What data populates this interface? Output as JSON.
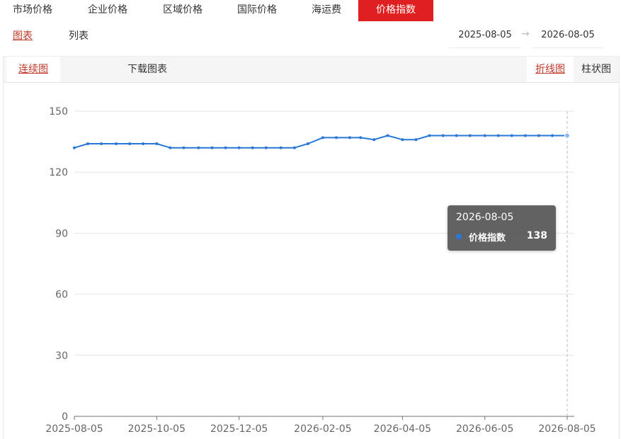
{
  "top_tabs": [
    "市场价格",
    "企业价格",
    "区域价格",
    "国际价格",
    "海运费",
    "价格指数"
  ],
  "sub_nav": {
    "chart": "图表",
    "list": "列表"
  },
  "date_range": {
    "start": "2025-08-05",
    "end": "2026-08-05",
    "separator": "→"
  },
  "toolbar": {
    "continuous_chart": "连续图",
    "download_chart": "下载图表",
    "line_chart": "折线图",
    "bar_chart": "柱状图"
  },
  "tooltip": {
    "date": "2026-08-05",
    "series_name": "价格指数",
    "value": "138"
  },
  "colors": {
    "accent": "#e02020",
    "series": "#2a78d6",
    "link": "#c0392b"
  },
  "chart_data": {
    "type": "line",
    "x_ticks": [
      "2025-08-05",
      "2025-10-05",
      "2025-12-05",
      "2026-02-05",
      "2026-04-05",
      "2026-06-05",
      "2026-08-05"
    ],
    "y_ticks": [
      0,
      30,
      60,
      90,
      120,
      150
    ],
    "ylim": [
      0,
      150
    ],
    "xlim": [
      "2025-08-05",
      "2026-08-05"
    ],
    "grid": true,
    "series": [
      {
        "name": "价格指数",
        "points": [
          [
            "2025-08-05",
            132
          ],
          [
            "2025-08-15",
            134
          ],
          [
            "2025-08-25",
            134
          ],
          [
            "2025-09-05",
            134
          ],
          [
            "2025-09-15",
            134
          ],
          [
            "2025-09-25",
            134
          ],
          [
            "2025-10-05",
            134
          ],
          [
            "2025-10-15",
            132
          ],
          [
            "2025-10-25",
            132
          ],
          [
            "2025-11-05",
            132
          ],
          [
            "2025-11-15",
            132
          ],
          [
            "2025-11-25",
            132
          ],
          [
            "2025-12-05",
            132
          ],
          [
            "2025-12-15",
            132
          ],
          [
            "2025-12-25",
            132
          ],
          [
            "2026-01-05",
            132
          ],
          [
            "2026-01-15",
            132
          ],
          [
            "2026-01-25",
            134
          ],
          [
            "2026-02-05",
            137
          ],
          [
            "2026-02-15",
            137
          ],
          [
            "2026-02-25",
            137
          ],
          [
            "2026-03-05",
            137
          ],
          [
            "2026-03-15",
            136
          ],
          [
            "2026-03-25",
            138
          ],
          [
            "2026-04-05",
            136
          ],
          [
            "2026-04-15",
            136
          ],
          [
            "2026-04-25",
            138
          ],
          [
            "2026-05-05",
            138
          ],
          [
            "2026-05-15",
            138
          ],
          [
            "2026-05-25",
            138
          ],
          [
            "2026-06-05",
            138
          ],
          [
            "2026-06-15",
            138
          ],
          [
            "2026-06-25",
            138
          ],
          [
            "2026-07-05",
            138
          ],
          [
            "2026-07-15",
            138
          ],
          [
            "2026-07-25",
            138
          ],
          [
            "2026-08-05",
            138
          ]
        ]
      }
    ]
  }
}
